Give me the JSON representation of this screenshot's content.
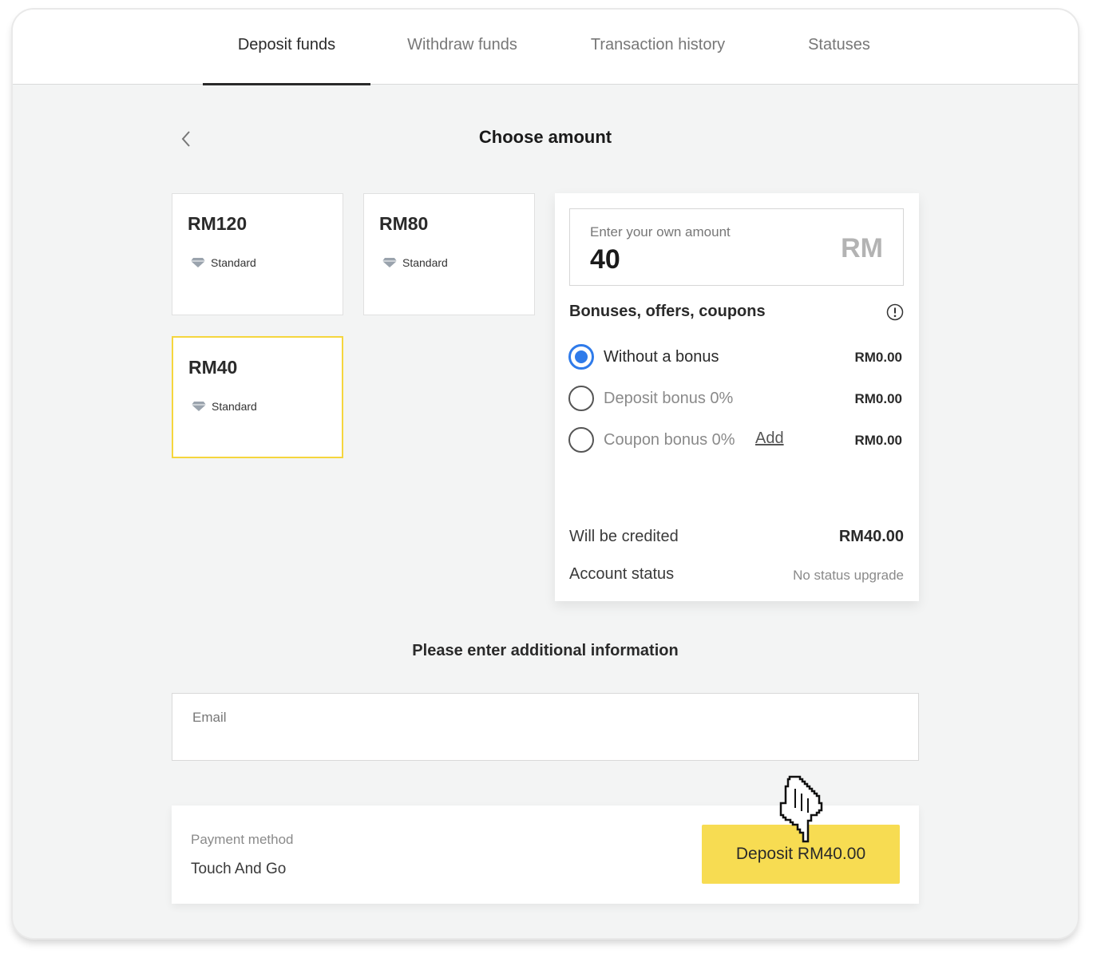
{
  "tabs": [
    {
      "label": "Deposit funds",
      "active": true
    },
    {
      "label": "Withdraw funds",
      "active": false
    },
    {
      "label": "Transaction history",
      "active": false
    },
    {
      "label": "Statuses",
      "active": false
    }
  ],
  "page": {
    "title": "Choose amount"
  },
  "preset_amounts": [
    {
      "amount": "RM120",
      "tier": "Standard"
    },
    {
      "amount": "RM80",
      "tier": "Standard"
    },
    {
      "amount": "RM40",
      "tier": "Standard",
      "selected": true
    }
  ],
  "amount_input": {
    "placeholder": "Enter your own amount",
    "value": "40",
    "currency": "RM"
  },
  "bonuses": {
    "heading": "Bonuses, offers, coupons",
    "options": [
      {
        "label": "Without a bonus",
        "value": "RM0.00",
        "selected": true
      },
      {
        "label": "Deposit bonus 0%",
        "value": "RM0.00",
        "selected": false
      },
      {
        "label": "Coupon bonus 0%",
        "value": "RM0.00",
        "selected": false,
        "link": "Add"
      }
    ]
  },
  "summary": {
    "credited_label": "Will be credited",
    "credited_value": "RM40.00",
    "status_label": "Account status",
    "status_value": "No status upgrade"
  },
  "additional": {
    "title": "Please enter additional information",
    "email_placeholder": "Email"
  },
  "payment": {
    "label": "Payment method",
    "method": "Touch And Go",
    "button": "Deposit RM40.00"
  },
  "colors": {
    "accent": "#f7dc52",
    "radio": "#2f7bea",
    "selected_border": "#f5d63e"
  }
}
